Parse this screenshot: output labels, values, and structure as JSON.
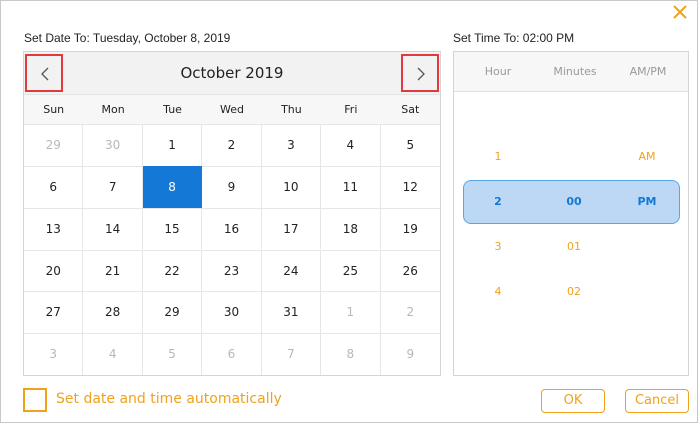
{
  "dialog": {
    "date_label": "Set Date To: Tuesday, October 8, 2019",
    "time_label": "Set Time To: 02:00 PM"
  },
  "calendar": {
    "month_title": "October 2019",
    "weekdays": [
      "Sun",
      "Mon",
      "Tue",
      "Wed",
      "Thu",
      "Fri",
      "Sat"
    ],
    "weeks": [
      [
        {
          "d": "29",
          "m": true
        },
        {
          "d": "30",
          "m": true
        },
        {
          "d": "1"
        },
        {
          "d": "2"
        },
        {
          "d": "3"
        },
        {
          "d": "4"
        },
        {
          "d": "5"
        }
      ],
      [
        {
          "d": "6"
        },
        {
          "d": "7"
        },
        {
          "d": "8",
          "s": true
        },
        {
          "d": "9"
        },
        {
          "d": "10"
        },
        {
          "d": "11"
        },
        {
          "d": "12"
        }
      ],
      [
        {
          "d": "13"
        },
        {
          "d": "14"
        },
        {
          "d": "15"
        },
        {
          "d": "16"
        },
        {
          "d": "17"
        },
        {
          "d": "18"
        },
        {
          "d": "19"
        }
      ],
      [
        {
          "d": "20"
        },
        {
          "d": "21"
        },
        {
          "d": "22"
        },
        {
          "d": "23"
        },
        {
          "d": "24"
        },
        {
          "d": "25"
        },
        {
          "d": "26"
        }
      ],
      [
        {
          "d": "27"
        },
        {
          "d": "28"
        },
        {
          "d": "29"
        },
        {
          "d": "30"
        },
        {
          "d": "31"
        },
        {
          "d": "1",
          "m": true
        },
        {
          "d": "2",
          "m": true
        }
      ],
      [
        {
          "d": "3",
          "m": true
        },
        {
          "d": "4",
          "m": true
        },
        {
          "d": "5",
          "m": true
        },
        {
          "d": "6",
          "m": true
        },
        {
          "d": "7",
          "m": true
        },
        {
          "d": "8",
          "m": true
        },
        {
          "d": "9",
          "m": true
        }
      ]
    ]
  },
  "time": {
    "headers": {
      "hour": "Hour",
      "minutes": "Minutes",
      "ampm": "AM/PM"
    },
    "hours": [
      "1",
      "2",
      "3",
      "4"
    ],
    "selected_hour": "2",
    "minutes": [
      "00",
      "01",
      "02"
    ],
    "selected_minute": "00",
    "ampm": [
      "AM",
      "PM"
    ],
    "selected_ampm": "PM"
  },
  "footer": {
    "auto_label": "Set date and time automatically",
    "ok_label": "OK",
    "cancel_label": "Cancel"
  },
  "colors": {
    "accent": "#f0a21b",
    "selected": "#1479d6",
    "nav_highlight": "#e0393e"
  }
}
